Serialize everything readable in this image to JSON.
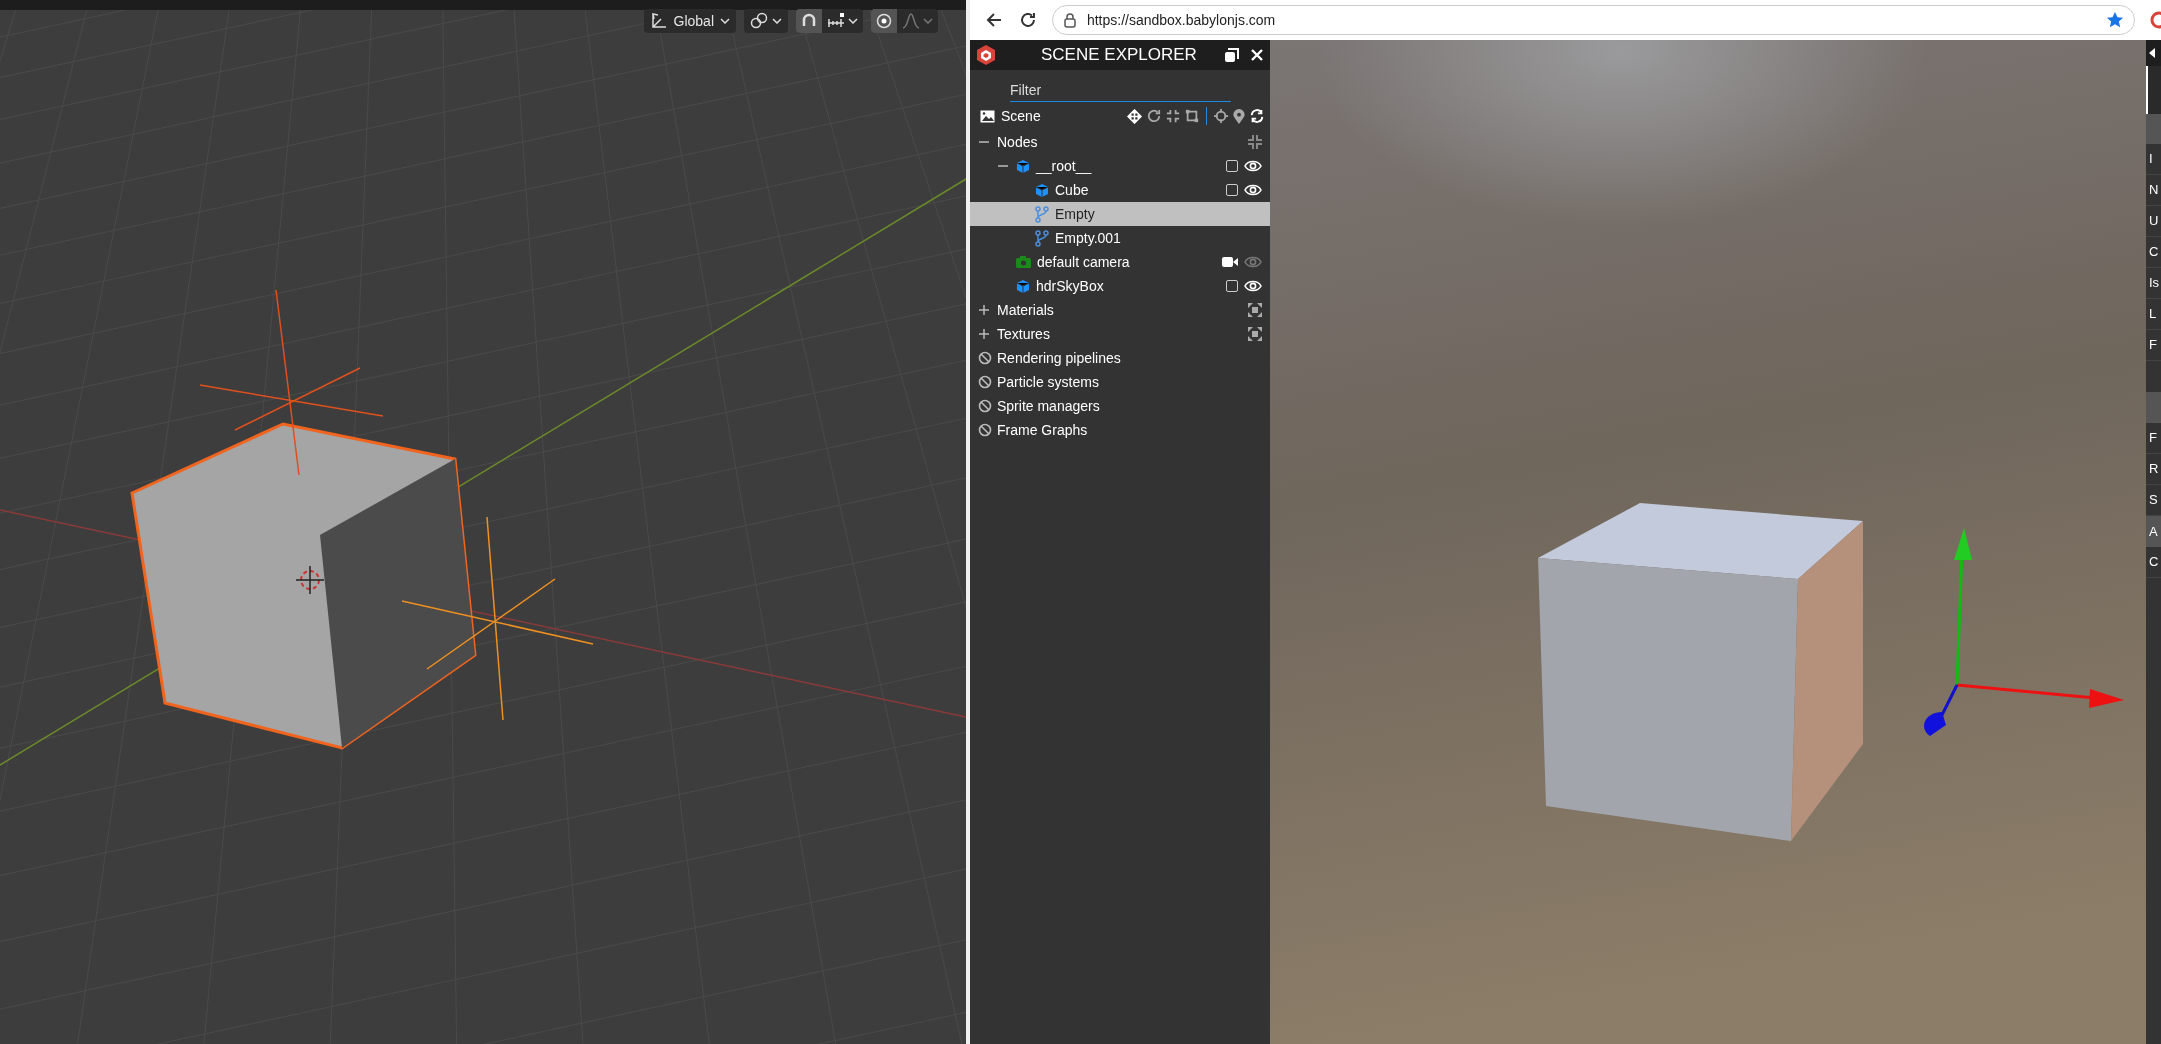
{
  "blender": {
    "header": {
      "orientation": "Global",
      "snap_on": true,
      "proportional_on": true
    }
  },
  "browser": {
    "url": "https://sandbox.babylonjs.com"
  },
  "scene_explorer": {
    "title": "SCENE EXPLORER",
    "filter": {
      "placeholder": "Filter"
    },
    "scene": {
      "label": "Scene"
    },
    "tree": [
      {
        "label": "Nodes",
        "kind": "group",
        "expanded": true,
        "selected": false,
        "children": [
          {
            "label": "__root__",
            "kind": "mesh",
            "expanded": true,
            "selected": false,
            "checked": false,
            "visible": true,
            "children": [
              {
                "label": "Cube",
                "kind": "mesh",
                "selected": false,
                "checked": false,
                "visible": true
              },
              {
                "label": "Empty",
                "kind": "transform",
                "selected": true
              },
              {
                "label": "Empty.001",
                "kind": "transform",
                "selected": false
              }
            ]
          },
          {
            "label": "default camera",
            "kind": "camera",
            "selected": false,
            "visible": false
          },
          {
            "label": "hdrSkyBox",
            "kind": "mesh",
            "selected": false,
            "checked": false,
            "visible": true
          }
        ]
      },
      {
        "label": "Materials",
        "kind": "group",
        "expanded": false,
        "selected": false
      },
      {
        "label": "Textures",
        "kind": "group",
        "expanded": false,
        "selected": false
      },
      {
        "label": "Rendering pipelines",
        "kind": "none",
        "selected": false
      },
      {
        "label": "Particle systems",
        "kind": "none",
        "selected": false
      },
      {
        "label": "Sprite managers",
        "kind": "none",
        "selected": false
      },
      {
        "label": "Frame Graphs",
        "kind": "none",
        "selected": false
      }
    ]
  },
  "inspector_edge": [
    {
      "text": "I",
      "kind": "row"
    },
    {
      "text": "N",
      "kind": "row"
    },
    {
      "text": "U",
      "kind": "row"
    },
    {
      "text": "C",
      "kind": "row"
    },
    {
      "text": "Is",
      "kind": "row"
    },
    {
      "text": "L",
      "kind": "row"
    },
    {
      "text": "F",
      "kind": "row"
    },
    {
      "kind": "gap"
    },
    {
      "kind": "header"
    },
    {
      "text": "F",
      "kind": "row"
    },
    {
      "text": "R",
      "kind": "row"
    },
    {
      "text": "S",
      "kind": "row"
    },
    {
      "text": "A",
      "kind": "header"
    },
    {
      "text": "C",
      "kind": "row"
    }
  ]
}
